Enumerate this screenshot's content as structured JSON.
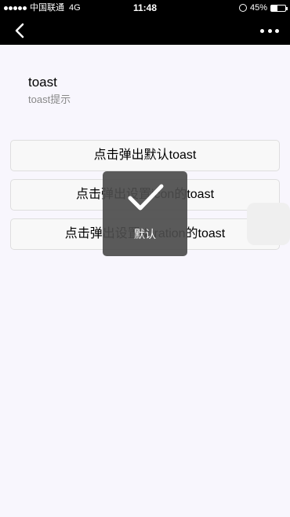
{
  "status_bar": {
    "carrier": "中国联通",
    "network": "4G",
    "time": "11:48",
    "battery": "45%",
    "battery_level": 0.45
  },
  "nav": {
    "back_icon": "chevron-left-icon",
    "more_icon": "more-dots-icon"
  },
  "page": {
    "title": "toast",
    "subtitle": "toast提示"
  },
  "buttons": [
    {
      "label": "点击弹出默认toast"
    },
    {
      "label": "点击弹出设置icon的toast"
    },
    {
      "label": "点击弹出设置duration的toast"
    }
  ],
  "toast": {
    "icon": "checkmark-icon",
    "text": "默认"
  },
  "colors": {
    "nav_background": "#000000",
    "page_background": "#f8f6fd",
    "toast_background": "#4c4c4c"
  }
}
